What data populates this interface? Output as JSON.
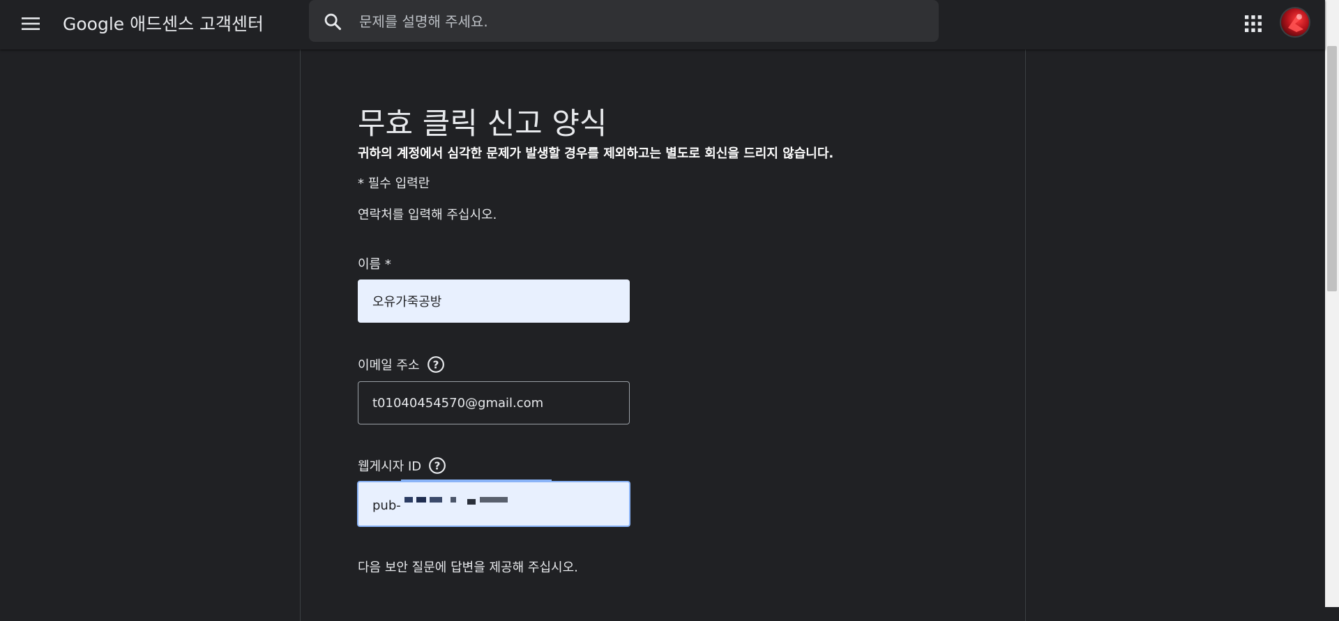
{
  "header": {
    "brand": "Google 애드센스 고객센터",
    "search_placeholder": "문제를 설명해 주세요."
  },
  "form": {
    "title": "무효 클릭 신고 양식",
    "notice": "귀하의 계정에서 심각한 문제가 발생할 경우를 제외하고는 별도로 회신을 드리지 않습니다.",
    "required_note": "* 필수 입력란",
    "contact_intro": "연락처를 입력해 주십시오.",
    "name": {
      "label": "이름 *",
      "value": "오유가죽공방"
    },
    "email": {
      "label": "이메일 주소",
      "value": "t01040454570@gmail.com"
    },
    "publisher_id": {
      "label": "웹게시자 ID",
      "value": "pub-"
    },
    "security_intro": "다음 보안 질문에 답변을 제공해 주십시오."
  },
  "icons": {
    "menu": "menu-icon",
    "search": "search-icon",
    "apps": "apps-grid-icon",
    "help": "help-circle-icon"
  },
  "colors": {
    "background": "#202124",
    "search_bg": "#303134",
    "filled_input": "#e8f0fe",
    "focus_accent": "#8ab4f8"
  }
}
